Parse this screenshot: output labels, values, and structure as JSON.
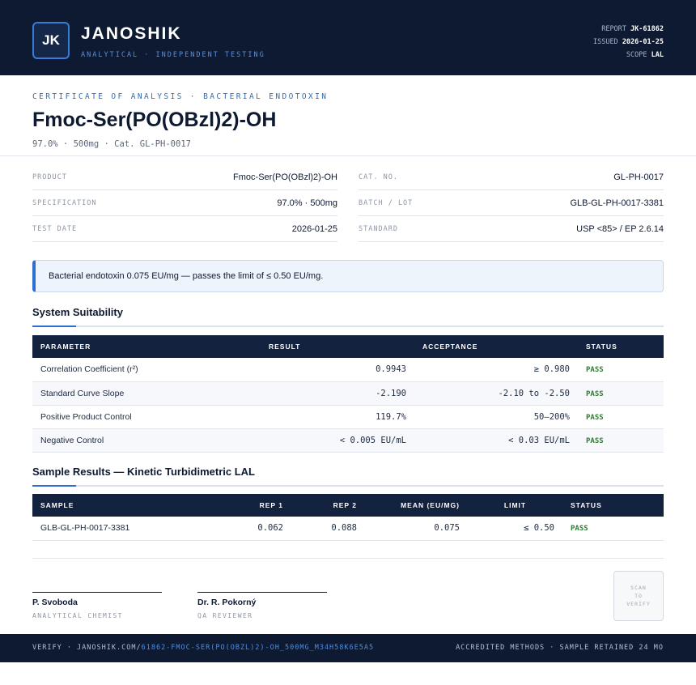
{
  "header": {
    "logo": "JK",
    "brand": "JANOSHIK",
    "tagline": "ANALYTICAL · INDEPENDENT TESTING",
    "report_label": "REPORT",
    "report_value": "JK-61862",
    "issued_label": "ISSUED",
    "issued_value": "2026-01-25",
    "scope_label": "SCOPE",
    "scope_value": "LAL"
  },
  "title": {
    "kicker": "CERTIFICATE OF ANALYSIS · BACTERIAL ENDOTOXIN",
    "product": "Fmoc-Ser(PO(OBzl)2)-OH",
    "subtitle": "97.0% · 500mg  ·  Cat. GL-PH-0017"
  },
  "info_left": [
    {
      "label": "PRODUCT",
      "value": "Fmoc-Ser(PO(OBzl)2)-OH"
    },
    {
      "label": "SPECIFICATION",
      "value": "97.0% · 500mg"
    },
    {
      "label": "TEST DATE",
      "value": "2026-01-25"
    }
  ],
  "info_right": [
    {
      "label": "CAT. NO.",
      "value": "GL-PH-0017"
    },
    {
      "label": "BATCH / LOT",
      "value": "GLB-GL-PH-0017-3381"
    },
    {
      "label": "STANDARD",
      "value": "USP <85> / EP 2.6.14"
    }
  ],
  "banner": "Bacterial endotoxin 0.075 EU/mg — passes the limit of ≤ 0.50 EU/mg.",
  "suitability": {
    "heading": "System Suitability",
    "headers": [
      "PARAMETER",
      "RESULT",
      "ACCEPTANCE",
      "STATUS"
    ],
    "rows": [
      [
        "Correlation Coefficient (r²)",
        "0.9943",
        "≥ 0.980",
        "PASS"
      ],
      [
        "Standard Curve Slope",
        "-2.190",
        "-2.10 to -2.50",
        "PASS"
      ],
      [
        "Positive Product Control",
        "119.7%",
        "50–200%",
        "PASS"
      ],
      [
        "Negative Control",
        "< 0.005 EU/mL",
        "< 0.03 EU/mL",
        "PASS"
      ]
    ]
  },
  "samples": {
    "heading": "Sample Results — Kinetic Turbidimetric LAL",
    "headers": [
      "SAMPLE",
      "REP 1",
      "REP 2",
      "MEAN (EU/MG)",
      "LIMIT",
      "STATUS"
    ],
    "rows": [
      [
        "GLB-GL-PH-0017-3381",
        "0.062",
        "0.088",
        "0.075",
        "≤ 0.50",
        "PASS"
      ]
    ]
  },
  "signatures": [
    {
      "name": "P. Svoboda",
      "role": "ANALYTICAL CHEMIST"
    },
    {
      "name": "Dr. R. Pokorný",
      "role": "QA REVIEWER"
    }
  ],
  "qr": {
    "line1": "SCAN",
    "line2": "TO",
    "line3": "VERIFY"
  },
  "footer": {
    "verify_prefix": "VERIFY · JANOSHIK.COM/",
    "verify_path": "61862-FMOC-SER(PO(OBZL)2)-OH_500MG_M34H58K6E5A5",
    "right": "ACCREDITED METHODS · SAMPLE RETAINED 24 MO"
  }
}
